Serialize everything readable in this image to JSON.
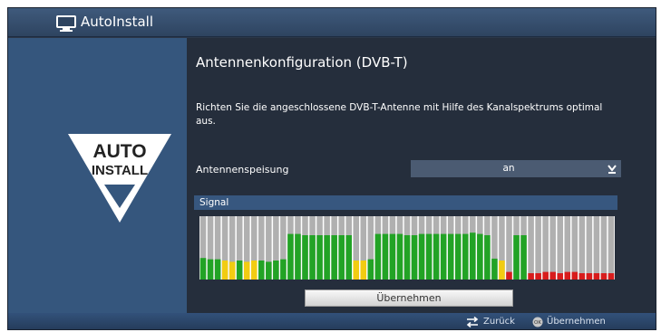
{
  "header": {
    "title": "AutoInstall",
    "icon": "tv-icon"
  },
  "logo": {
    "line1": "AUTO",
    "line2": "INSTALL"
  },
  "main": {
    "heading": "Antennenkonfiguration (DVB-T)",
    "description": "Richten Sie die angeschlossene DVB-T-Antenne mit Hilfe des Kanalspektrums optimal aus.",
    "antenna": {
      "label": "Antennenspeisung",
      "value": "an"
    },
    "signal_label": "Signal",
    "apply_button": "Übernehmen"
  },
  "spectrum": {
    "channel_levels": [
      0.34,
      0.32,
      0.32,
      0.3,
      0.28,
      0.3,
      0.28,
      0.3,
      0.3,
      0.28,
      0.3,
      0.32,
      0.72,
      0.72,
      0.7,
      0.7,
      0.7,
      0.7,
      0.7,
      0.7,
      0.7,
      0.3,
      0.3,
      0.32,
      0.72,
      0.72,
      0.72,
      0.72,
      0.7,
      0.7,
      0.72,
      0.72,
      0.72,
      0.72,
      0.72,
      0.72,
      0.72,
      0.74,
      0.72,
      0.7,
      0.33,
      0.3,
      0.12,
      0.7,
      0.7,
      0.1,
      0.1,
      0.12,
      0.12,
      0.1,
      0.12,
      0.12,
      0.1,
      0.1,
      0.1,
      0.1,
      0.1
    ],
    "channel_colors": [
      "green",
      "green",
      "green",
      "yellow",
      "yellow",
      "green",
      "yellow",
      "yellow",
      "green",
      "green",
      "green",
      "green",
      "green",
      "green",
      "green",
      "green",
      "green",
      "green",
      "green",
      "green",
      "green",
      "yellow",
      "yellow",
      "green",
      "green",
      "green",
      "green",
      "green",
      "green",
      "green",
      "green",
      "green",
      "green",
      "green",
      "green",
      "green",
      "green",
      "green",
      "green",
      "green",
      "green",
      "yellow",
      "red",
      "green",
      "green",
      "red",
      "red",
      "red",
      "red",
      "red",
      "red",
      "red",
      "red",
      "red",
      "red",
      "red",
      "red"
    ],
    "palette": {
      "green": "#22a325",
      "yellow": "#f2cc12",
      "red": "#d81c1c",
      "empty": "#b0b0b0"
    }
  },
  "footer": {
    "back_label": "Zurück",
    "apply_label": "Übernehmen",
    "back_icon": "swap-arrows-icon",
    "ok_icon": "ok-button-icon"
  }
}
